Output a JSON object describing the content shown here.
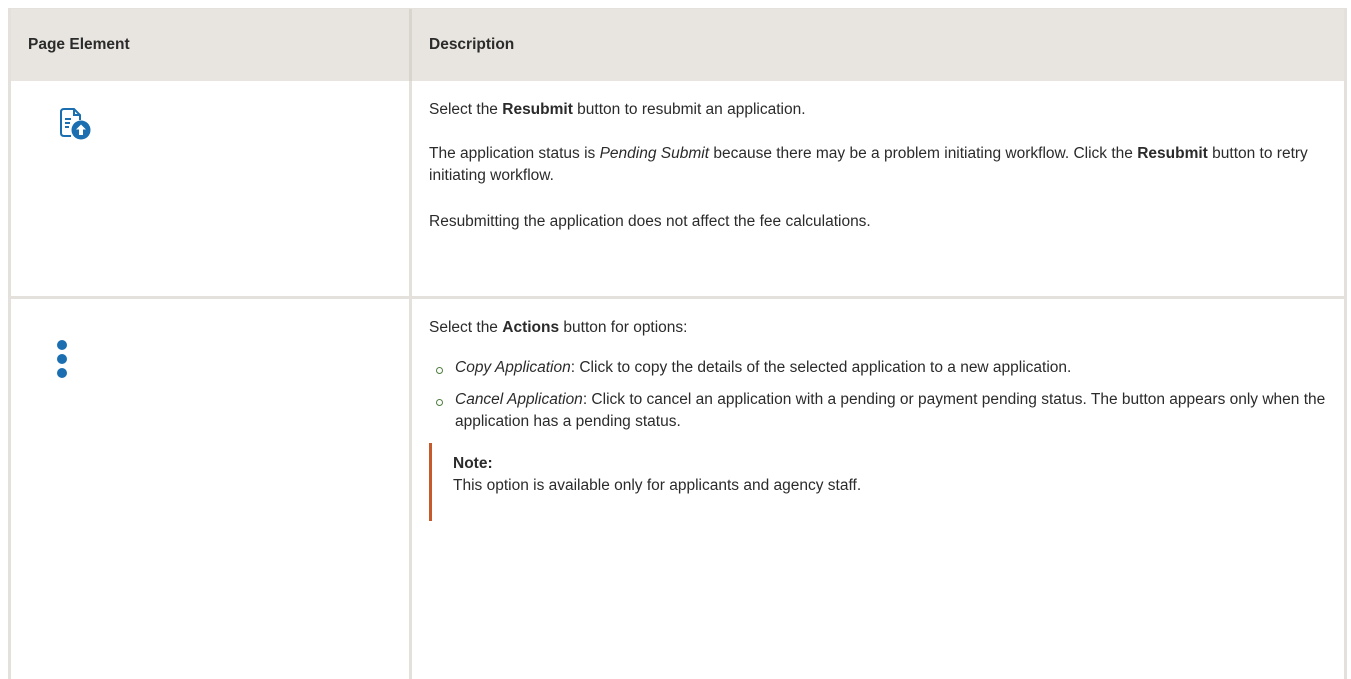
{
  "table": {
    "headers": {
      "page_element": "Page Element",
      "description": "Description"
    },
    "rows": [
      {
        "icon": "resubmit-document-upload-icon",
        "paragraphs": {
          "p1_pre": "Select the ",
          "p1_bold": "Resubmit",
          "p1_post": " button to resubmit an application.",
          "p2_pre": "The application status is ",
          "p2_italic": "Pending Submit",
          "p2_mid": " because there may be a problem initiating workflow. Click the ",
          "p2_bold": "Resubmit",
          "p2_post": " button to retry initiating workflow.",
          "p3": "Resubmitting the application does not affect the fee calculations."
        }
      },
      {
        "icon": "vertical-dots-actions-icon",
        "intro_pre": "Select the ",
        "intro_bold": "Actions",
        "intro_post": " button for options:",
        "options": [
          {
            "name": "Copy Application",
            "text": ": Click to copy the details of the selected application to a new application."
          },
          {
            "name": "Cancel Application",
            "text": ": Click to cancel an application with a pending or payment pending status. The button appears only when the application has a pending status."
          }
        ],
        "note": {
          "title": "Note:",
          "text": "This option is available only for applicants and agency staff."
        }
      }
    ]
  },
  "colors": {
    "icon_blue": "#1b6fb0",
    "note_bar": "#c55a2c",
    "header_bg": "#e8e5e0"
  }
}
